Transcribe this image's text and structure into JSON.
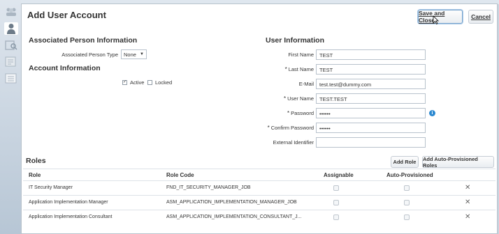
{
  "dialog": {
    "title": "Add User Account",
    "save_label": "Save and Close",
    "cancel_label": "Cancel"
  },
  "associated_person": {
    "heading": "Associated Person Information",
    "type_label": "Associated Person Type",
    "type_value": "None"
  },
  "account": {
    "heading": "Account Information",
    "active_label": "Active",
    "active_checked": true,
    "locked_label": "Locked",
    "locked_checked": false
  },
  "user_info": {
    "heading": "User Information",
    "first_name_label": "First Name",
    "first_name": "TEST",
    "last_name_label": "Last Name",
    "last_name": "TEST",
    "email_label": "E-Mail",
    "email": "test.test@dummy.com",
    "user_name_label": "User Name",
    "user_name": "TEST.TEST",
    "password_label": "Password",
    "password": "••••••",
    "confirm_password_label": "Confirm Password",
    "confirm_password": "••••••",
    "external_id_label": "External Identifier",
    "external_id": "",
    "required_marker": "*"
  },
  "roles": {
    "heading": "Roles",
    "add_role_label": "Add Role",
    "add_auto_label": "Add Auto-Provisioned Roles",
    "columns": [
      "Role",
      "Role Code",
      "Assignable",
      "Auto-Provisioned"
    ],
    "rows": [
      {
        "role": "IT Security Manager",
        "code": "FND_IT_SECURITY_MANAGER_JOB"
      },
      {
        "role": "Application Implementation Manager",
        "code": "ASM_APPLICATION_IMPLEMENTATION_MANAGER_JOB"
      },
      {
        "role": "Application Implementation Consultant",
        "code": "ASM_APPLICATION_IMPLEMENTATION_CONSULTANT_J..."
      }
    ],
    "delete_glyph": "✕"
  },
  "icons": [
    "people-icon",
    "person-icon",
    "search-person-icon",
    "report-icon",
    "list-icon",
    "info-icon",
    "cursor-icon"
  ],
  "colors": {
    "accent": "#2a88d0",
    "save_border": "#7aa6cf"
  }
}
